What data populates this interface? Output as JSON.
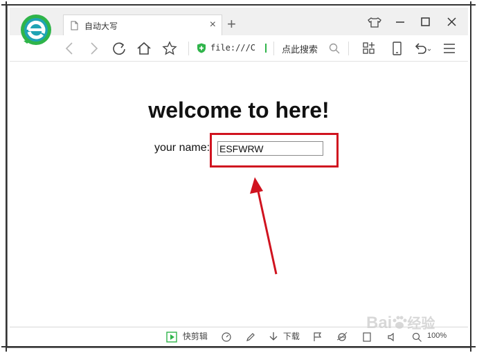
{
  "browser": {
    "tab_title": "自动大写",
    "new_tab_symbol": "+",
    "tab_close_symbol": "×",
    "address_url": "file:///C",
    "search_placeholder": "点此搜索"
  },
  "page": {
    "heading": "welcome to here!",
    "name_label": "your name:",
    "name_value": "ESFWRW"
  },
  "annotation": {
    "highlight_color": "#d0131f"
  },
  "statusbar": {
    "quick_edit_label": "快剪辑",
    "download_label": "下载",
    "zoom_level": "100%"
  },
  "watermark": {
    "text_latin": "Bai",
    "text_cn": "经验"
  },
  "icons": {
    "logo": "browser-e-logo",
    "back": "chevron-left-icon",
    "forward": "chevron-right-icon",
    "refresh": "refresh-icon",
    "home": "home-icon",
    "favorite": "star-icon",
    "secure": "shield-plus-icon",
    "search": "search-icon",
    "apps": "apps-icon",
    "mobile": "mobile-icon",
    "undo": "undo-icon",
    "menu": "menu-icon"
  },
  "colors": {
    "logo_green": "#2fb44a",
    "logo_teal": "#1fa3b4",
    "accent_green": "#2fb44a"
  }
}
